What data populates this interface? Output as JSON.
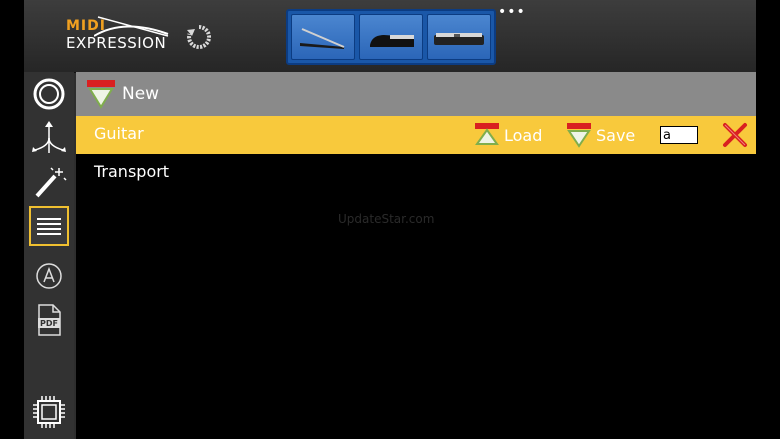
{
  "header": {
    "logo_top": "MIDI",
    "logo_bottom": "EXPRESSION",
    "more_label": "•••"
  },
  "toolbar": {
    "new_label": "New"
  },
  "presets": [
    {
      "name": "Guitar",
      "selected": true
    },
    {
      "name": "Transport",
      "selected": false
    }
  ],
  "selected_row": {
    "load_label": "Load",
    "save_label": "Save",
    "name_input_value": "a"
  },
  "watermark": "UpdateStar.com",
  "colors": {
    "accent": "#f8c93c",
    "toolbar": "#8a8a8a",
    "pedal_blue": "#1a57a8",
    "delete_red": "#d92020"
  }
}
